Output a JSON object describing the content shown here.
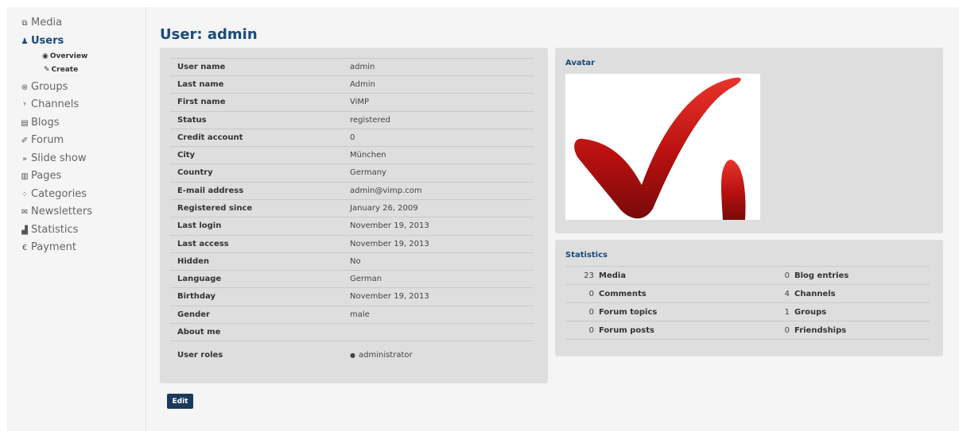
{
  "sidebar": {
    "items": [
      {
        "icon": "media-icon",
        "glyph": "⧉",
        "label": "Media"
      },
      {
        "icon": "users-icon",
        "glyph": "♟",
        "label": "Users"
      },
      {
        "icon": "groups-icon",
        "glyph": "⊛",
        "label": "Groups"
      },
      {
        "icon": "channels-icon",
        "glyph": "ᵞ",
        "label": "Channels"
      },
      {
        "icon": "blogs-icon",
        "glyph": "▤",
        "label": "Blogs"
      },
      {
        "icon": "forum-icon",
        "glyph": "✐",
        "label": "Forum"
      },
      {
        "icon": "slideshow-icon",
        "glyph": "»",
        "label": "Slide show"
      },
      {
        "icon": "pages-icon",
        "glyph": "▥",
        "label": "Pages"
      },
      {
        "icon": "categories-icon",
        "glyph": "⁘",
        "label": "Categories"
      },
      {
        "icon": "newsletters-icon",
        "glyph": "✉",
        "label": "Newsletters"
      },
      {
        "icon": "statistics-icon",
        "glyph": "▟",
        "label": "Statistics"
      },
      {
        "icon": "payment-icon",
        "glyph": "€",
        "label": "Payment"
      }
    ],
    "users_sub": [
      {
        "icon": "eye-icon",
        "glyph": "◉",
        "label": "Overview"
      },
      {
        "icon": "pencil-icon",
        "glyph": "✎",
        "label": "Create"
      }
    ],
    "active": "Users"
  },
  "page": {
    "title": "User: admin"
  },
  "details": [
    {
      "label": "User name",
      "value": "admin"
    },
    {
      "label": "Last name",
      "value": "Admin"
    },
    {
      "label": "First name",
      "value": "ViMP"
    },
    {
      "label": "Status",
      "value": "registered"
    },
    {
      "label": "Credit account",
      "value": "0"
    },
    {
      "label": "City",
      "value": "München"
    },
    {
      "label": "Country",
      "value": "Germany"
    },
    {
      "label": "E-mail address",
      "value": "admin@vimp.com"
    },
    {
      "label": "Registered since",
      "value": "January 26, 2009"
    },
    {
      "label": "Last login",
      "value": "November 19, 2013"
    },
    {
      "label": "Last access",
      "value": "November 19, 2013"
    },
    {
      "label": "Hidden",
      "value": "No"
    },
    {
      "label": "Language",
      "value": "German"
    },
    {
      "label": "Birthday",
      "value": "November 19, 2013"
    },
    {
      "label": "Gender",
      "value": "male"
    },
    {
      "label": "About me",
      "value": ""
    }
  ],
  "roles": {
    "label": "User roles",
    "items": [
      "administrator"
    ]
  },
  "avatar": {
    "title": "Avatar"
  },
  "statistics": {
    "title": "Statistics",
    "rows": [
      {
        "left": {
          "count": "23",
          "label": "Media"
        },
        "right": {
          "count": "0",
          "label": "Blog entries"
        }
      },
      {
        "left": {
          "count": "0",
          "label": "Comments"
        },
        "right": {
          "count": "4",
          "label": "Channels"
        }
      },
      {
        "left": {
          "count": "0",
          "label": "Forum topics"
        },
        "right": {
          "count": "1",
          "label": "Groups"
        }
      },
      {
        "left": {
          "count": "0",
          "label": "Forum posts"
        },
        "right": {
          "count": "0",
          "label": "Friendships"
        }
      }
    ]
  },
  "actions": {
    "edit_label": "Edit"
  },
  "colors": {
    "accent": "#1a4a7a",
    "button": "#1a3a5c",
    "panel": "#dedede",
    "logo_red": "#b81010"
  }
}
